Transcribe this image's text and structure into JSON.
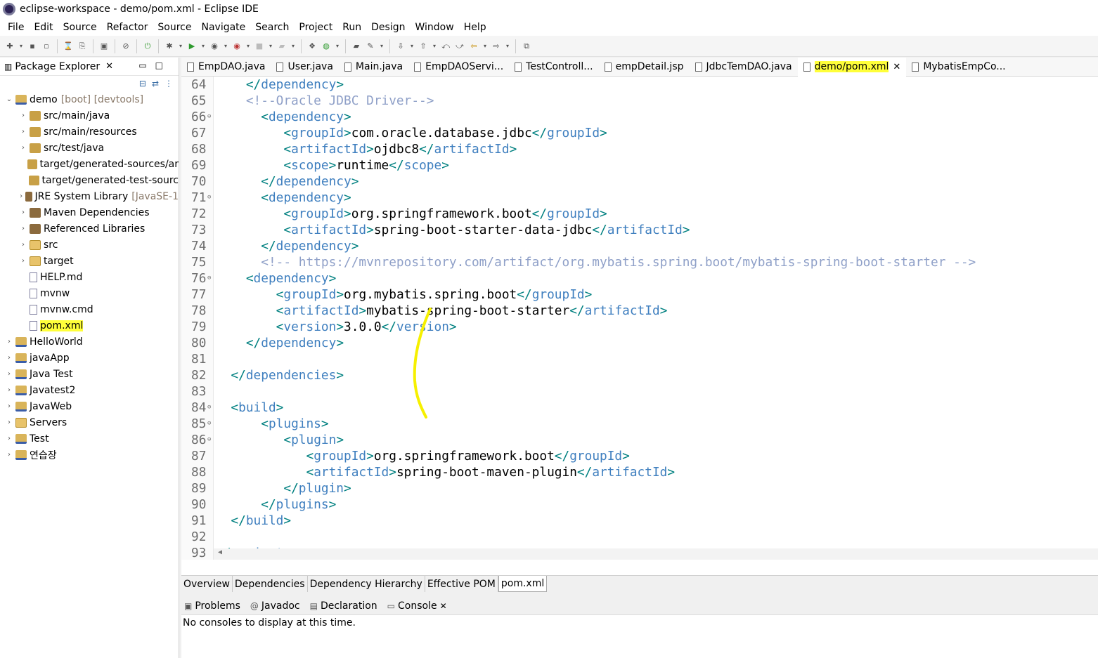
{
  "window": {
    "title": "eclipse-workspace - demo/pom.xml - Eclipse IDE"
  },
  "menu": [
    "File",
    "Edit",
    "Source",
    "Refactor",
    "Source",
    "Navigate",
    "Search",
    "Project",
    "Run",
    "Design",
    "Window",
    "Help"
  ],
  "package_explorer": {
    "title": "Package Explorer",
    "items": [
      {
        "indent": 0,
        "arrow": "⌄",
        "icon": "proj",
        "label": "demo",
        "suffix": "[boot] [devtools]"
      },
      {
        "indent": 1,
        "arrow": "›",
        "icon": "pkg",
        "label": "src/main/java",
        "suffix": ""
      },
      {
        "indent": 1,
        "arrow": "›",
        "icon": "pkg",
        "label": "src/main/resources",
        "suffix": ""
      },
      {
        "indent": 1,
        "arrow": "›",
        "icon": "pkg",
        "label": "src/test/java",
        "suffix": ""
      },
      {
        "indent": 1,
        "arrow": "",
        "icon": "pkg",
        "label": "target/generated-sources/ar",
        "suffix": ""
      },
      {
        "indent": 1,
        "arrow": "",
        "icon": "pkg",
        "label": "target/generated-test-sourc",
        "suffix": ""
      },
      {
        "indent": 1,
        "arrow": "›",
        "icon": "lib",
        "label": "JRE System Library",
        "suffix": "[JavaSE-1"
      },
      {
        "indent": 1,
        "arrow": "›",
        "icon": "lib",
        "label": "Maven Dependencies",
        "suffix": ""
      },
      {
        "indent": 1,
        "arrow": "›",
        "icon": "lib",
        "label": "Referenced Libraries",
        "suffix": ""
      },
      {
        "indent": 1,
        "arrow": "›",
        "icon": "fld",
        "label": "src",
        "suffix": ""
      },
      {
        "indent": 1,
        "arrow": "›",
        "icon": "fld",
        "label": "target",
        "suffix": ""
      },
      {
        "indent": 1,
        "arrow": "",
        "icon": "file",
        "label": "HELP.md",
        "suffix": ""
      },
      {
        "indent": 1,
        "arrow": "",
        "icon": "file",
        "label": "mvnw",
        "suffix": ""
      },
      {
        "indent": 1,
        "arrow": "",
        "icon": "file",
        "label": "mvnw.cmd",
        "suffix": ""
      },
      {
        "indent": 1,
        "arrow": "",
        "icon": "file",
        "label": "pom.xml",
        "suffix": "",
        "highlight": true
      },
      {
        "indent": 0,
        "arrow": "›",
        "icon": "proj",
        "label": "HelloWorld",
        "suffix": ""
      },
      {
        "indent": 0,
        "arrow": "›",
        "icon": "proj",
        "label": "javaApp",
        "suffix": ""
      },
      {
        "indent": 0,
        "arrow": "›",
        "icon": "proj",
        "label": "Java Test",
        "suffix": ""
      },
      {
        "indent": 0,
        "arrow": "›",
        "icon": "proj",
        "label": "Javatest2",
        "suffix": ""
      },
      {
        "indent": 0,
        "arrow": "›",
        "icon": "proj",
        "label": "JavaWeb",
        "suffix": ""
      },
      {
        "indent": 0,
        "arrow": "›",
        "icon": "fld",
        "label": "Servers",
        "suffix": ""
      },
      {
        "indent": 0,
        "arrow": "›",
        "icon": "proj",
        "label": "Test",
        "suffix": ""
      },
      {
        "indent": 0,
        "arrow": "›",
        "icon": "proj",
        "label": "연습장",
        "suffix": ""
      }
    ]
  },
  "editor_tabs": [
    {
      "label": "EmpDAO.java",
      "active": false
    },
    {
      "label": "User.java",
      "active": false
    },
    {
      "label": "Main.java",
      "active": false
    },
    {
      "label": "EmpDAOServi...",
      "active": false
    },
    {
      "label": "TestControll...",
      "active": false
    },
    {
      "label": "empDetail.jsp",
      "active": false
    },
    {
      "label": "JdbcTemDAO.java",
      "active": false
    },
    {
      "label": "demo/pom.xml",
      "active": true
    },
    {
      "label": "MybatisEmpCo...",
      "active": false
    }
  ],
  "code_lines": [
    {
      "n": "64",
      "fold": false,
      "html": "    <span class='br'>&lt;/</span><span class='tag'>dependency</span><span class='br'>&gt;</span>"
    },
    {
      "n": "65",
      "fold": false,
      "html": "    <span class='cmt'>&lt;!--Oracle JDBC Driver--&gt;</span>"
    },
    {
      "n": "66",
      "fold": true,
      "html": "      <span class='br'>&lt;</span><span class='tag'>dependency</span><span class='br'>&gt;</span>"
    },
    {
      "n": "67",
      "fold": false,
      "html": "         <span class='br'>&lt;</span><span class='tag'>groupId</span><span class='br'>&gt;</span>com.oracle.database.jdbc<span class='br'>&lt;/</span><span class='tag'>groupId</span><span class='br'>&gt;</span>"
    },
    {
      "n": "68",
      "fold": false,
      "html": "         <span class='br'>&lt;</span><span class='tag'>artifactId</span><span class='br'>&gt;</span>ojdbc8<span class='br'>&lt;/</span><span class='tag'>artifactId</span><span class='br'>&gt;</span>"
    },
    {
      "n": "69",
      "fold": false,
      "html": "         <span class='br'>&lt;</span><span class='tag'>scope</span><span class='br'>&gt;</span>runtime<span class='br'>&lt;/</span><span class='tag'>scope</span><span class='br'>&gt;</span>"
    },
    {
      "n": "70",
      "fold": false,
      "html": "      <span class='br'>&lt;/</span><span class='tag'>dependency</span><span class='br'>&gt;</span>"
    },
    {
      "n": "71",
      "fold": true,
      "html": "      <span class='br'>&lt;</span><span class='tag'>dependency</span><span class='br'>&gt;</span>"
    },
    {
      "n": "72",
      "fold": false,
      "html": "         <span class='br'>&lt;</span><span class='tag'>groupId</span><span class='br'>&gt;</span>org.springframework.boot<span class='br'>&lt;/</span><span class='tag'>groupId</span><span class='br'>&gt;</span>"
    },
    {
      "n": "73",
      "fold": false,
      "html": "         <span class='br'>&lt;</span><span class='tag'>artifactId</span><span class='br'>&gt;</span>spring-boot-starter-data-jdbc<span class='br'>&lt;/</span><span class='tag'>artifactId</span><span class='br'>&gt;</span>"
    },
    {
      "n": "74",
      "fold": false,
      "html": "      <span class='br'>&lt;/</span><span class='tag'>dependency</span><span class='br'>&gt;</span>"
    },
    {
      "n": "75",
      "fold": false,
      "html": "      <span class='cmt'>&lt;!-- https://mvnrepository.com/artifact/org.mybatis.spring.boot/mybatis-spring-boot-starter --&gt;</span>"
    },
    {
      "n": "76",
      "fold": true,
      "html": "    <span class='br'>&lt;</span><span class='tag'>dependency</span><span class='br'>&gt;</span>"
    },
    {
      "n": "77",
      "fold": false,
      "html": "        <span class='br'>&lt;</span><span class='tag'>groupId</span><span class='br'>&gt;</span>org.mybatis.spring.boot<span class='br'>&lt;/</span><span class='tag'>groupId</span><span class='br'>&gt;</span>"
    },
    {
      "n": "78",
      "fold": false,
      "html": "        <span class='br'>&lt;</span><span class='tag'>artifactId</span><span class='br'>&gt;</span>mybatis-spring-boot-starter<span class='br'>&lt;/</span><span class='tag'>artifactId</span><span class='br'>&gt;</span>"
    },
    {
      "n": "79",
      "fold": false,
      "html": "        <span class='br'>&lt;</span><span class='tag'>version</span><span class='br'>&gt;</span>3.0.0<span class='br'>&lt;/</span><span class='tag'>version</span><span class='br'>&gt;</span>"
    },
    {
      "n": "80",
      "fold": false,
      "html": "    <span class='br'>&lt;/</span><span class='tag'>dependency</span><span class='br'>&gt;</span>"
    },
    {
      "n": "81",
      "fold": false,
      "html": ""
    },
    {
      "n": "82",
      "fold": false,
      "html": "  <span class='br'>&lt;/</span><span class='tag'>dependencies</span><span class='br'>&gt;</span>"
    },
    {
      "n": "83",
      "fold": false,
      "html": ""
    },
    {
      "n": "84",
      "fold": true,
      "html": "  <span class='br'>&lt;</span><span class='tag'>build</span><span class='br'>&gt;</span>"
    },
    {
      "n": "85",
      "fold": true,
      "html": "      <span class='br'>&lt;</span><span class='tag'>plugins</span><span class='br'>&gt;</span>"
    },
    {
      "n": "86",
      "fold": true,
      "html": "         <span class='br'>&lt;</span><span class='tag'>plugin</span><span class='br'>&gt;</span>"
    },
    {
      "n": "87",
      "fold": false,
      "html": "            <span class='br'>&lt;</span><span class='tag'>groupId</span><span class='br'>&gt;</span>org.springframework.boot<span class='br'>&lt;/</span><span class='tag'>groupId</span><span class='br'>&gt;</span>"
    },
    {
      "n": "88",
      "fold": false,
      "html": "            <span class='br'>&lt;</span><span class='tag'>artifactId</span><span class='br'>&gt;</span>spring-boot-maven-plugin<span class='br'>&lt;/</span><span class='tag'>artifactId</span><span class='br'>&gt;</span>"
    },
    {
      "n": "89",
      "fold": false,
      "html": "         <span class='br'>&lt;/</span><span class='tag'>plugin</span><span class='br'>&gt;</span>"
    },
    {
      "n": "90",
      "fold": false,
      "html": "      <span class='br'>&lt;/</span><span class='tag'>plugins</span><span class='br'>&gt;</span>"
    },
    {
      "n": "91",
      "fold": false,
      "html": "  <span class='br'>&lt;/</span><span class='tag'>build</span><span class='br'>&gt;</span>"
    },
    {
      "n": "92",
      "fold": false,
      "html": ""
    },
    {
      "n": "93",
      "fold": false,
      "html": "<span class='br'>&lt;/</span><span class='tag'>project</span><span class='br'>&gt;</span>"
    }
  ],
  "pom_tabs": [
    "Overview",
    "Dependencies",
    "Dependency Hierarchy",
    "Effective POM",
    "pom.xml"
  ],
  "pom_active": "pom.xml",
  "bottom_tabs": [
    {
      "label": "Problems",
      "icon": "problems-icon",
      "glyph": "▣"
    },
    {
      "label": "Javadoc",
      "icon": "javadoc-icon",
      "glyph": "@"
    },
    {
      "label": "Declaration",
      "icon": "declaration-icon",
      "glyph": "▤"
    },
    {
      "label": "Console",
      "icon": "console-icon",
      "glyph": "▭",
      "closable": true
    }
  ],
  "console": {
    "message": "No consoles to display at this time."
  },
  "colors": {
    "highlight": "#ffff3a",
    "tag": "#3f7fbf",
    "comment": "#8fa0c8"
  }
}
